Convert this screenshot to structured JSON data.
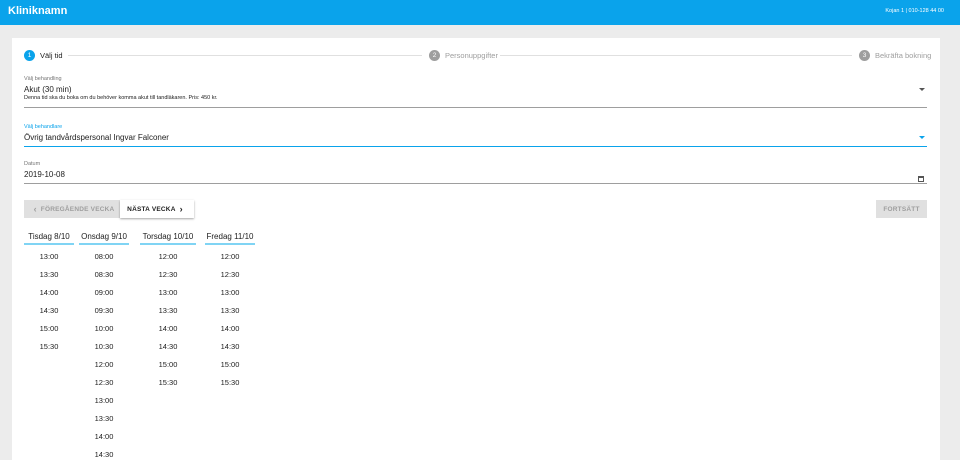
{
  "header": {
    "title": "Kliniknamn",
    "contact": "Kojan 1 | 010-128 44 00"
  },
  "steps": [
    {
      "number": "1",
      "label": "Välj tid"
    },
    {
      "number": "2",
      "label": "Personuppgifter"
    },
    {
      "number": "3",
      "label": "Bekräfta bokning"
    }
  ],
  "treatment": {
    "label": "Välj behandling",
    "value": "Akut (30 min)",
    "hint": "Denna tid ska du boka om du behöver komma akut till tandläkaren. Pris: 450 kr."
  },
  "practitioner": {
    "label": "Välj behandlare",
    "value": "Övrig tandvårdspersonal Ingvar Falconer"
  },
  "date": {
    "label": "Datum",
    "value": "2019-10-08"
  },
  "nav": {
    "prev_label": "FÖREGÅENDE VECKA",
    "next_label": "NÄSTA VECKA",
    "continue_label": "FORTSÄTT"
  },
  "days": [
    {
      "label": "Tisdag 8/10",
      "times": [
        "13:00",
        "13:30",
        "14:00",
        "14:30",
        "15:00",
        "15:30"
      ]
    },
    {
      "label": "Onsdag 9/10",
      "times": [
        "08:00",
        "08:30",
        "09:00",
        "09:30",
        "10:00",
        "10:30",
        "12:00",
        "12:30",
        "13:00",
        "13:30",
        "14:00",
        "14:30"
      ]
    },
    {
      "label": "Torsdag 10/10",
      "times": [
        "12:00",
        "12:30",
        "13:00",
        "13:30",
        "14:00",
        "14:30",
        "15:00",
        "15:30"
      ]
    },
    {
      "label": "Fredag 11/10",
      "times": [
        "12:00",
        "12:30",
        "13:00",
        "13:30",
        "14:00",
        "14:30",
        "15:00",
        "15:30"
      ]
    }
  ],
  "colors": {
    "accent": "#0aa3eb",
    "disabled": "#e0e0e0",
    "day_underline": "#80d4f4"
  }
}
